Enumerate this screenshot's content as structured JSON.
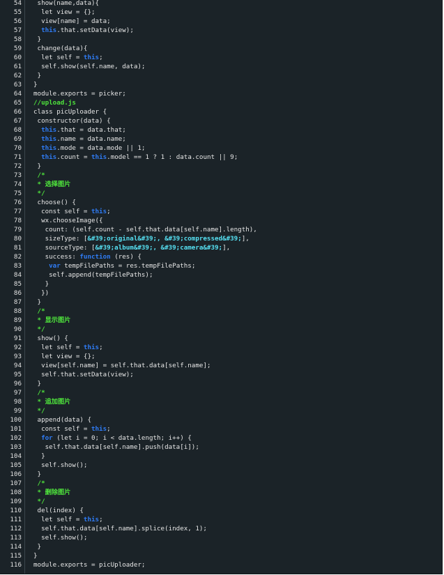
{
  "colors": {
    "background": "#1b2328",
    "text": "#e6e6e6",
    "keyword": "#2f7cf6",
    "comment": "#4ee23c",
    "string": "#56e0f2",
    "line_number": "#e0e0e0"
  },
  "lines": [
    {
      "n": "54",
      "tokens": [
        {
          "t": " show(name,data){",
          "c": "plain"
        }
      ]
    },
    {
      "n": "55",
      "tokens": [
        {
          "t": "  let view = {};",
          "c": "plain"
        }
      ]
    },
    {
      "n": "56",
      "tokens": [
        {
          "t": "  view[name] = data;",
          "c": "plain"
        }
      ]
    },
    {
      "n": "57",
      "tokens": [
        {
          "t": "  ",
          "c": "plain"
        },
        {
          "t": "this",
          "c": "kw"
        },
        {
          "t": ".that.setData(view);",
          "c": "plain"
        }
      ]
    },
    {
      "n": "58",
      "tokens": [
        {
          "t": " }",
          "c": "plain"
        }
      ]
    },
    {
      "n": "59",
      "tokens": [
        {
          "t": " change(data){",
          "c": "plain"
        }
      ]
    },
    {
      "n": "60",
      "tokens": [
        {
          "t": "  let self = ",
          "c": "plain"
        },
        {
          "t": "this",
          "c": "kw"
        },
        {
          "t": ";",
          "c": "plain"
        }
      ]
    },
    {
      "n": "61",
      "tokens": [
        {
          "t": "  self.show(self.name, data);",
          "c": "plain"
        }
      ]
    },
    {
      "n": "62",
      "tokens": [
        {
          "t": " }",
          "c": "plain"
        }
      ]
    },
    {
      "n": "63",
      "tokens": [
        {
          "t": "}",
          "c": "plain"
        }
      ]
    },
    {
      "n": "64",
      "tokens": [
        {
          "t": "module.exports = picker;",
          "c": "plain"
        }
      ]
    },
    {
      "n": "65",
      "tokens": [
        {
          "t": "//upload.js",
          "c": "comment"
        }
      ]
    },
    {
      "n": "66",
      "tokens": [
        {
          "t": "class picUploader {",
          "c": "plain"
        }
      ]
    },
    {
      "n": "67",
      "tokens": [
        {
          "t": " constructor(data) {",
          "c": "plain"
        }
      ]
    },
    {
      "n": "68",
      "tokens": [
        {
          "t": "  ",
          "c": "plain"
        },
        {
          "t": "this",
          "c": "kw"
        },
        {
          "t": ".that = data.that;",
          "c": "plain"
        }
      ]
    },
    {
      "n": "69",
      "tokens": [
        {
          "t": "  ",
          "c": "plain"
        },
        {
          "t": "this",
          "c": "kw"
        },
        {
          "t": ".name = data.name;",
          "c": "plain"
        }
      ]
    },
    {
      "n": "70",
      "tokens": [
        {
          "t": "  ",
          "c": "plain"
        },
        {
          "t": "this",
          "c": "kw"
        },
        {
          "t": ".mode = data.mode || 1;",
          "c": "plain"
        }
      ]
    },
    {
      "n": "71",
      "tokens": [
        {
          "t": "  ",
          "c": "plain"
        },
        {
          "t": "this",
          "c": "kw"
        },
        {
          "t": ".count = ",
          "c": "plain"
        },
        {
          "t": "this",
          "c": "kw"
        },
        {
          "t": ".model == 1 ? 1 : data.count || 9;",
          "c": "plain"
        }
      ]
    },
    {
      "n": "72",
      "tokens": [
        {
          "t": " }",
          "c": "plain"
        }
      ]
    },
    {
      "n": "73",
      "tokens": [
        {
          "t": " /*",
          "c": "comment"
        }
      ]
    },
    {
      "n": "74",
      "tokens": [
        {
          "t": " * 选择图片",
          "c": "comment"
        }
      ]
    },
    {
      "n": "75",
      "tokens": [
        {
          "t": " */",
          "c": "comment"
        }
      ]
    },
    {
      "n": "76",
      "tokens": [
        {
          "t": " choose() {",
          "c": "plain"
        }
      ]
    },
    {
      "n": "77",
      "tokens": [
        {
          "t": "  const self = ",
          "c": "plain"
        },
        {
          "t": "this",
          "c": "kw"
        },
        {
          "t": ";",
          "c": "plain"
        }
      ]
    },
    {
      "n": "78",
      "tokens": [
        {
          "t": "  wx.chooseImage({",
          "c": "plain"
        }
      ]
    },
    {
      "n": "79",
      "tokens": [
        {
          "t": "   count: (self.count - self.that.data[self.name].length),",
          "c": "plain"
        }
      ]
    },
    {
      "n": "80",
      "tokens": [
        {
          "t": "   sizeType: [",
          "c": "plain"
        },
        {
          "t": "&#39;original&#39;, &#39;compressed&#39;",
          "c": "str"
        },
        {
          "t": "],",
          "c": "plain"
        }
      ]
    },
    {
      "n": "81",
      "tokens": [
        {
          "t": "   sourceType: [",
          "c": "plain"
        },
        {
          "t": "&#39;album&#39;, &#39;camera&#39;",
          "c": "str"
        },
        {
          "t": "],",
          "c": "plain"
        }
      ]
    },
    {
      "n": "82",
      "tokens": [
        {
          "t": "   success: ",
          "c": "plain"
        },
        {
          "t": "function",
          "c": "kw"
        },
        {
          "t": " (res) {",
          "c": "plain"
        }
      ]
    },
    {
      "n": "83",
      "tokens": [
        {
          "t": "    ",
          "c": "plain"
        },
        {
          "t": "var",
          "c": "kw"
        },
        {
          "t": " tempFilePaths = res.tempFilePaths;",
          "c": "plain"
        }
      ]
    },
    {
      "n": "84",
      "tokens": [
        {
          "t": "    self.append(tempFilePaths);",
          "c": "plain"
        }
      ]
    },
    {
      "n": "85",
      "tokens": [
        {
          "t": "   }",
          "c": "plain"
        }
      ]
    },
    {
      "n": "86",
      "tokens": [
        {
          "t": "  })",
          "c": "plain"
        }
      ]
    },
    {
      "n": "87",
      "tokens": [
        {
          "t": " }",
          "c": "plain"
        }
      ]
    },
    {
      "n": "88",
      "tokens": [
        {
          "t": " /*",
          "c": "comment"
        }
      ]
    },
    {
      "n": "89",
      "tokens": [
        {
          "t": " * 显示图片",
          "c": "comment"
        }
      ]
    },
    {
      "n": "90",
      "tokens": [
        {
          "t": " */",
          "c": "comment"
        }
      ]
    },
    {
      "n": "91",
      "tokens": [
        {
          "t": " show() {",
          "c": "plain"
        }
      ]
    },
    {
      "n": "92",
      "tokens": [
        {
          "t": "  let self = ",
          "c": "plain"
        },
        {
          "t": "this",
          "c": "kw"
        },
        {
          "t": ";",
          "c": "plain"
        }
      ]
    },
    {
      "n": "93",
      "tokens": [
        {
          "t": "  let view = {};",
          "c": "plain"
        }
      ]
    },
    {
      "n": "94",
      "tokens": [
        {
          "t": "  view[self.name] = self.that.data[self.name];",
          "c": "plain"
        }
      ]
    },
    {
      "n": "95",
      "tokens": [
        {
          "t": "  self.that.setData(view);",
          "c": "plain"
        }
      ]
    },
    {
      "n": "96",
      "tokens": [
        {
          "t": " }",
          "c": "plain"
        }
      ]
    },
    {
      "n": "97",
      "tokens": [
        {
          "t": " /*",
          "c": "comment"
        }
      ]
    },
    {
      "n": "98",
      "tokens": [
        {
          "t": " * 追加图片",
          "c": "comment"
        }
      ]
    },
    {
      "n": "99",
      "tokens": [
        {
          "t": " */",
          "c": "comment"
        }
      ]
    },
    {
      "n": "100",
      "tokens": [
        {
          "t": " append(data) {",
          "c": "plain"
        }
      ]
    },
    {
      "n": "101",
      "tokens": [
        {
          "t": "  const self = ",
          "c": "plain"
        },
        {
          "t": "this",
          "c": "kw"
        },
        {
          "t": ";",
          "c": "plain"
        }
      ]
    },
    {
      "n": "102",
      "tokens": [
        {
          "t": "  ",
          "c": "plain"
        },
        {
          "t": "for",
          "c": "kw"
        },
        {
          "t": " (let i = 0; i < data.length; i++) {",
          "c": "plain"
        }
      ]
    },
    {
      "n": "103",
      "tokens": [
        {
          "t": "   self.that.data[self.name].push(data[i]);",
          "c": "plain"
        }
      ]
    },
    {
      "n": "104",
      "tokens": [
        {
          "t": "  }",
          "c": "plain"
        }
      ]
    },
    {
      "n": "105",
      "tokens": [
        {
          "t": "  self.show();",
          "c": "plain"
        }
      ]
    },
    {
      "n": "106",
      "tokens": [
        {
          "t": " }",
          "c": "plain"
        }
      ]
    },
    {
      "n": "107",
      "tokens": [
        {
          "t": " /*",
          "c": "comment"
        }
      ]
    },
    {
      "n": "108",
      "tokens": [
        {
          "t": " * 删除图片",
          "c": "comment"
        }
      ]
    },
    {
      "n": "109",
      "tokens": [
        {
          "t": " */",
          "c": "comment"
        }
      ]
    },
    {
      "n": "110",
      "tokens": [
        {
          "t": " del(index) {",
          "c": "plain"
        }
      ]
    },
    {
      "n": "111",
      "tokens": [
        {
          "t": "  let self = ",
          "c": "plain"
        },
        {
          "t": "this",
          "c": "kw"
        },
        {
          "t": ";",
          "c": "plain"
        }
      ]
    },
    {
      "n": "112",
      "tokens": [
        {
          "t": "  self.that.data[self.name].splice(index, 1);",
          "c": "plain"
        }
      ]
    },
    {
      "n": "113",
      "tokens": [
        {
          "t": "  self.show();",
          "c": "plain"
        }
      ]
    },
    {
      "n": "114",
      "tokens": [
        {
          "t": " }",
          "c": "plain"
        }
      ]
    },
    {
      "n": "115",
      "tokens": [
        {
          "t": "}",
          "c": "plain"
        }
      ]
    },
    {
      "n": "116",
      "tokens": [
        {
          "t": "module.exports = picUploader;",
          "c": "plain"
        }
      ]
    }
  ]
}
